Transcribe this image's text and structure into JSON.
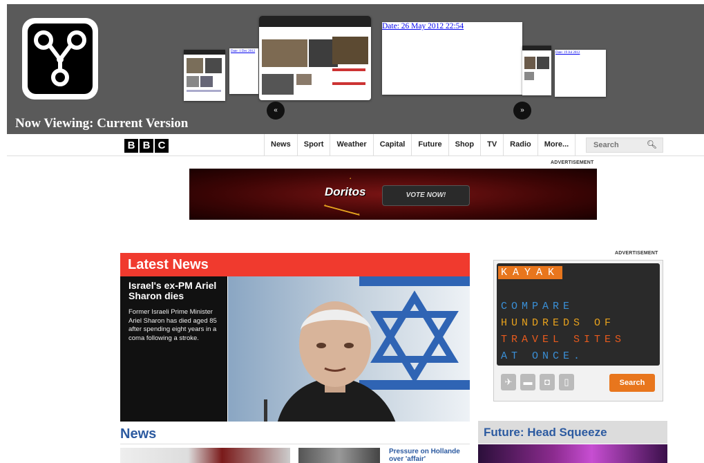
{
  "wayback": {
    "now_viewing": "Now Viewing: Current Version",
    "capture_date_link": "Date: 26 May 2012 22:54",
    "small_link_left": "Date: 1 Dec 2012",
    "small_link_right": "Date: 19 Jul 2012",
    "prev_symbol": "«",
    "next_symbol": "»"
  },
  "bbc": {
    "logo_letters": [
      "B",
      "B",
      "C"
    ],
    "nav": [
      "News",
      "Sport",
      "Weather",
      "Capital",
      "Future",
      "Shop",
      "TV",
      "Radio",
      "More..."
    ],
    "search_placeholder": "Search",
    "search_icon": "magnifier-icon"
  },
  "ads": {
    "label": "ADVERTISEMENT",
    "banner_brand": "Doritos",
    "banner_button": "VOTE NOW!",
    "kayak": {
      "logo": "KAYAK",
      "lines": [
        "COMPARE",
        "HUNDREDS OF",
        "TRAVEL SITES",
        "AT ONCE."
      ],
      "icons": [
        "plane-icon",
        "bed-icon",
        "car-icon",
        "phone-icon"
      ],
      "button": "Search"
    }
  },
  "latest": {
    "heading": "Latest News",
    "headline": "Israel's ex-PM Ariel Sharon dies",
    "summary": "Former Israeli Prime Minister Ariel Sharon has died aged 85 after spending eight years in a coma following a stroke."
  },
  "sections": {
    "news": "News",
    "future": "Future: Head Squeeze",
    "news_link": "Pressure on Hollande over 'affair'"
  },
  "colors": {
    "wayback_bg": "#5a5a5a",
    "latest_red": "#f03a2e",
    "bbc_blue": "#2c5aa0",
    "kayak_orange": "#e8761d"
  }
}
